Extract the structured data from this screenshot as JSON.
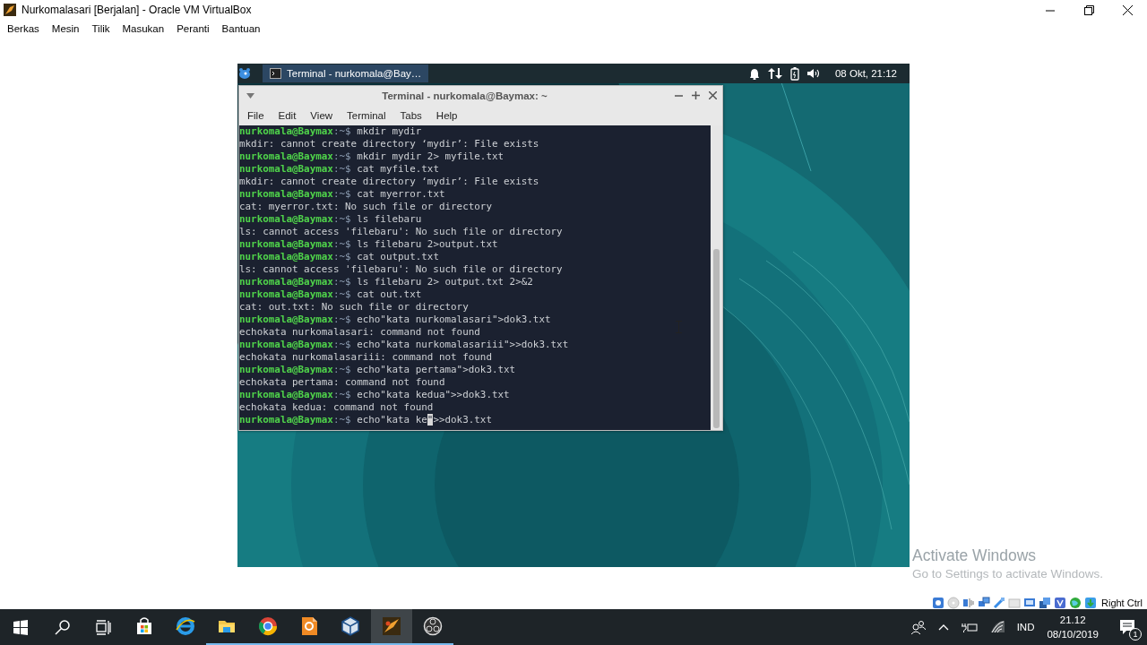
{
  "window": {
    "title": "Nurkomalasari [Berjalan] - Oracle VM VirtualBox"
  },
  "menu": [
    "Berkas",
    "Mesin",
    "Tilik",
    "Masukan",
    "Peranti",
    "Bantuan"
  ],
  "guest": {
    "panel": {
      "tasks": [
        {
          "label": "Terminal - nurkomala@Bay…",
          "selected": true
        }
      ],
      "clock": "08 Okt, 21:12"
    },
    "terminal": {
      "title": "Terminal - nurkomala@Baymax: ~",
      "menu": [
        "File",
        "Edit",
        "View",
        "Terminal",
        "Tabs",
        "Help"
      ],
      "lines": [
        {
          "kind": "prompt",
          "user": "nurkomala@Baymax",
          "path": ":~$",
          "command": "mkdir mydir"
        },
        {
          "kind": "output",
          "text": "mkdir: cannot create directory ‘mydir’: File exists"
        },
        {
          "kind": "prompt",
          "user": "nurkomala@Baymax",
          "path": ":~$",
          "command": "mkdir mydir 2> myfile.txt"
        },
        {
          "kind": "prompt",
          "user": "nurkomala@Baymax",
          "path": ":~$",
          "command": "cat myfile.txt"
        },
        {
          "kind": "output",
          "text": "mkdir: cannot create directory ‘mydir’: File exists"
        },
        {
          "kind": "prompt",
          "user": "nurkomala@Baymax",
          "path": ":~$",
          "command": "cat myerror.txt"
        },
        {
          "kind": "output",
          "text": "cat: myerror.txt: No such file or directory"
        },
        {
          "kind": "prompt",
          "user": "nurkomala@Baymax",
          "path": ":~$",
          "command": "ls filebaru"
        },
        {
          "kind": "output",
          "text": "ls: cannot access 'filebaru': No such file or directory"
        },
        {
          "kind": "prompt",
          "user": "nurkomala@Baymax",
          "path": ":~$",
          "command": "ls filebaru 2>output.txt"
        },
        {
          "kind": "prompt",
          "user": "nurkomala@Baymax",
          "path": ":~$",
          "command": "cat output.txt"
        },
        {
          "kind": "output",
          "text": "ls: cannot access 'filebaru': No such file or directory"
        },
        {
          "kind": "prompt",
          "user": "nurkomala@Baymax",
          "path": ":~$",
          "command": "ls filebaru 2> output.txt 2>&2"
        },
        {
          "kind": "prompt",
          "user": "nurkomala@Baymax",
          "path": ":~$",
          "command": "cat out.txt"
        },
        {
          "kind": "output",
          "text": "cat: out.txt: No such file or directory"
        },
        {
          "kind": "prompt",
          "user": "nurkomala@Baymax",
          "path": ":~$",
          "command": "echo\"kata nurkomalasari\">dok3.txt"
        },
        {
          "kind": "output",
          "text": "echokata nurkomalasari: command not found"
        },
        {
          "kind": "prompt",
          "user": "nurkomala@Baymax",
          "path": ":~$",
          "command": "echo\"kata nurkomalasariii\">>dok3.txt"
        },
        {
          "kind": "output",
          "text": "echokata nurkomalasariii: command not found"
        },
        {
          "kind": "prompt",
          "user": "nurkomala@Baymax",
          "path": ":~$",
          "command": "echo\"kata pertama\">dok3.txt"
        },
        {
          "kind": "output",
          "text": "echokata pertama: command not found"
        },
        {
          "kind": "prompt",
          "user": "nurkomala@Baymax",
          "path": ":~$",
          "command": "echo\"kata kedua\">>dok3.txt"
        },
        {
          "kind": "output",
          "text": "echokata kedua: command not found"
        },
        {
          "kind": "prompt",
          "user": "nurkomala@Baymax",
          "path": ":~$",
          "command": "echo\"kata ke",
          "cursor": "\"",
          "command_rest": ">>dok3.txt"
        }
      ]
    }
  },
  "vm_status": {
    "host_key": "Right Ctrl"
  },
  "activation": {
    "title": "Activate Windows",
    "message": "Go to Settings to activate Windows."
  },
  "taskbar": {
    "apps": [
      {
        "kind": "store",
        "running": false,
        "selected": false
      },
      {
        "kind": "edge",
        "running": false,
        "selected": false
      },
      {
        "kind": "folder",
        "running": true,
        "selected": false
      },
      {
        "kind": "chrome",
        "running": true,
        "selected": false
      },
      {
        "kind": "document",
        "running": true,
        "selected": false
      },
      {
        "kind": "cube",
        "running": true,
        "selected": false
      },
      {
        "kind": "app",
        "running": true,
        "selected": true
      },
      {
        "kind": "obs",
        "running": true,
        "selected": false
      }
    ],
    "language": "IND",
    "time": "21.12",
    "date": "08/10/2019",
    "notifications": "1"
  }
}
